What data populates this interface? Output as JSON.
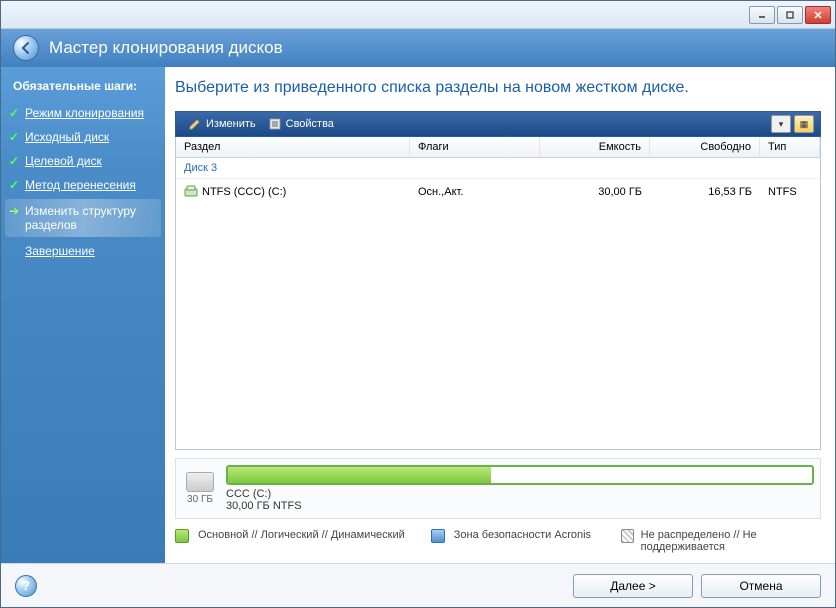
{
  "window": {
    "title": "Мастер клонирования дисков"
  },
  "sidebar": {
    "title": "Обязательные шаги:",
    "steps": [
      {
        "label": "Режим клонирования",
        "state": "done"
      },
      {
        "label": "Исходный диск",
        "state": "done"
      },
      {
        "label": "Целевой диск",
        "state": "done"
      },
      {
        "label": "Метод перенесения",
        "state": "done"
      },
      {
        "label": "Изменить структуру разделов",
        "state": "current"
      },
      {
        "label": "Завершение",
        "state": "pending"
      }
    ]
  },
  "main": {
    "instruction": "Выберите из приведенного списка разделы на новом жестком диске.",
    "toolbar": {
      "edit": "Изменить",
      "properties": "Свойства"
    },
    "grid": {
      "columns": {
        "partition": "Раздел",
        "flags": "Флаги",
        "capacity": "Емкость",
        "free": "Свободно",
        "type": "Тип"
      },
      "group": "Диск 3",
      "rows": [
        {
          "partition": "NTFS (CCC) (C:)",
          "flags": "Осн.,Акт.",
          "capacity": "30,00 ГБ",
          "free": "16,53 ГБ",
          "type": "NTFS"
        }
      ]
    },
    "diskbar": {
      "thumb": "30 ГБ",
      "label_line1": "CCC (C:)",
      "label_line2": "30,00 ГБ  NTFS",
      "fill_percent": 45
    },
    "legend": {
      "primary": "Основной // Логический // Динамический",
      "zone": "Зона безопасности Acronis",
      "unalloc": "Не распределено // Не поддерживается"
    }
  },
  "footer": {
    "next": "Далее >",
    "cancel": "Отмена"
  }
}
